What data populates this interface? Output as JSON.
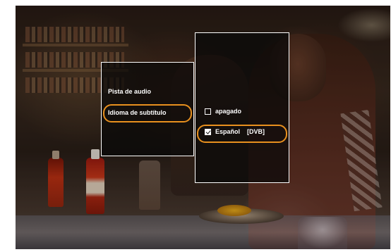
{
  "menu": {
    "items": [
      {
        "label": "Pista de audio",
        "focused": false
      },
      {
        "label": "Idioma de subtítulo",
        "focused": true
      }
    ]
  },
  "subtitle_options": [
    {
      "label": "apagado",
      "tag": "",
      "checked": false,
      "focused": false
    },
    {
      "label": "Español",
      "tag": "[DVB]",
      "checked": true,
      "focused": true
    }
  ],
  "colors": {
    "focus_ring": "#e8901e",
    "panel_border": "#ffffff",
    "text": "#ffffff"
  }
}
